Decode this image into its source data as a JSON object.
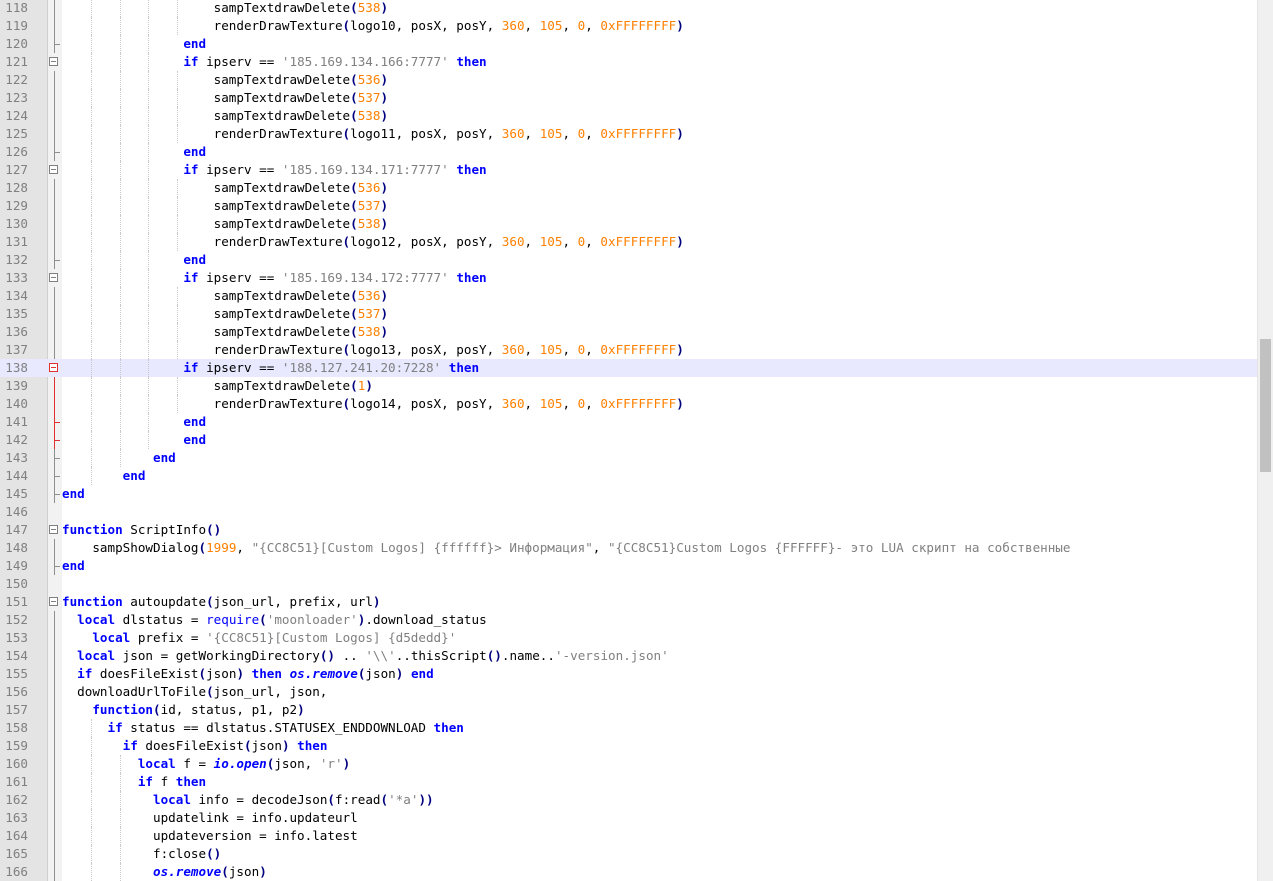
{
  "editor": {
    "language": "lua",
    "first_line_number": 118,
    "current_line": 138
  },
  "lines": [
    {
      "n": "118",
      "t": "                    sampTextdrawDelete(538)"
    },
    {
      "n": "119",
      "t": "                    renderDrawTexture(logo10, posX, posY, 360, 105, 0, 0xFFFFFFFF)"
    },
    {
      "n": "120",
      "t": "                end"
    },
    {
      "n": "121",
      "t": "                if ipserv == '185.169.134.166:7777' then"
    },
    {
      "n": "122",
      "t": "                    sampTextdrawDelete(536)"
    },
    {
      "n": "123",
      "t": "                    sampTextdrawDelete(537)"
    },
    {
      "n": "124",
      "t": "                    sampTextdrawDelete(538)"
    },
    {
      "n": "125",
      "t": "                    renderDrawTexture(logo11, posX, posY, 360, 105, 0, 0xFFFFFFFF)"
    },
    {
      "n": "126",
      "t": "                end"
    },
    {
      "n": "127",
      "t": "                if ipserv == '185.169.134.171:7777' then"
    },
    {
      "n": "128",
      "t": "                    sampTextdrawDelete(536)"
    },
    {
      "n": "129",
      "t": "                    sampTextdrawDelete(537)"
    },
    {
      "n": "130",
      "t": "                    sampTextdrawDelete(538)"
    },
    {
      "n": "131",
      "t": "                    renderDrawTexture(logo12, posX, posY, 360, 105, 0, 0xFFFFFFFF)"
    },
    {
      "n": "132",
      "t": "                end"
    },
    {
      "n": "133",
      "t": "                if ipserv == '185.169.134.172:7777' then"
    },
    {
      "n": "134",
      "t": "                    sampTextdrawDelete(536)"
    },
    {
      "n": "135",
      "t": "                    sampTextdrawDelete(537)"
    },
    {
      "n": "136",
      "t": "                    sampTextdrawDelete(538)"
    },
    {
      "n": "137",
      "t": "                    renderDrawTexture(logo13, posX, posY, 360, 105, 0, 0xFFFFFFFF)"
    },
    {
      "n": "138",
      "t": "                if ipserv == '188.127.241.20:7228' then"
    },
    {
      "n": "139",
      "t": "                    sampTextdrawDelete(1)"
    },
    {
      "n": "140",
      "t": "                    renderDrawTexture(logo14, posX, posY, 360, 105, 0, 0xFFFFFFFF)"
    },
    {
      "n": "141",
      "t": "                end"
    },
    {
      "n": "142",
      "t": "                end"
    },
    {
      "n": "143",
      "t": "            end"
    },
    {
      "n": "144",
      "t": "        end"
    },
    {
      "n": "145",
      "t": "end"
    },
    {
      "n": "146",
      "t": ""
    },
    {
      "n": "147",
      "t": "function ScriptInfo()"
    },
    {
      "n": "148",
      "t": "    sampShowDialog(1999, \"{CC8C51}[Custom Logos] {ffffff}> Информация\", \"{CC8C51}Custom Logos {FFFFFF}- это LUA скрипт на собственные"
    },
    {
      "n": "149",
      "t": "end"
    },
    {
      "n": "150",
      "t": ""
    },
    {
      "n": "151",
      "t": "function autoupdate(json_url, prefix, url)"
    },
    {
      "n": "152",
      "t": "  local dlstatus = require('moonloader').download_status"
    },
    {
      "n": "153",
      "t": "    local prefix = '{CC8C51}[Custom Logos] {d5dedd}'"
    },
    {
      "n": "154",
      "t": "  local json = getWorkingDirectory() .. '\\\\'..thisScript().name..'-version.json'"
    },
    {
      "n": "155",
      "t": "  if doesFileExist(json) then os.remove(json) end"
    },
    {
      "n": "156",
      "t": "  downloadUrlToFile(json_url, json,"
    },
    {
      "n": "157",
      "t": "    function(id, status, p1, p2)"
    },
    {
      "n": "158",
      "t": "      if status == dlstatus.STATUSEX_ENDDOWNLOAD then"
    },
    {
      "n": "159",
      "t": "        if doesFileExist(json) then"
    },
    {
      "n": "160",
      "t": "          local f = io.open(json, 'r')"
    },
    {
      "n": "161",
      "t": "          if f then"
    },
    {
      "n": "162",
      "t": "            local info = decodeJson(f:read('*a'))"
    },
    {
      "n": "163",
      "t": "            updatelink = info.updateurl"
    },
    {
      "n": "164",
      "t": "            updateversion = info.latest"
    },
    {
      "n": "165",
      "t": "            f:close()"
    },
    {
      "n": "166",
      "t": "            os.remove(json)"
    }
  ]
}
